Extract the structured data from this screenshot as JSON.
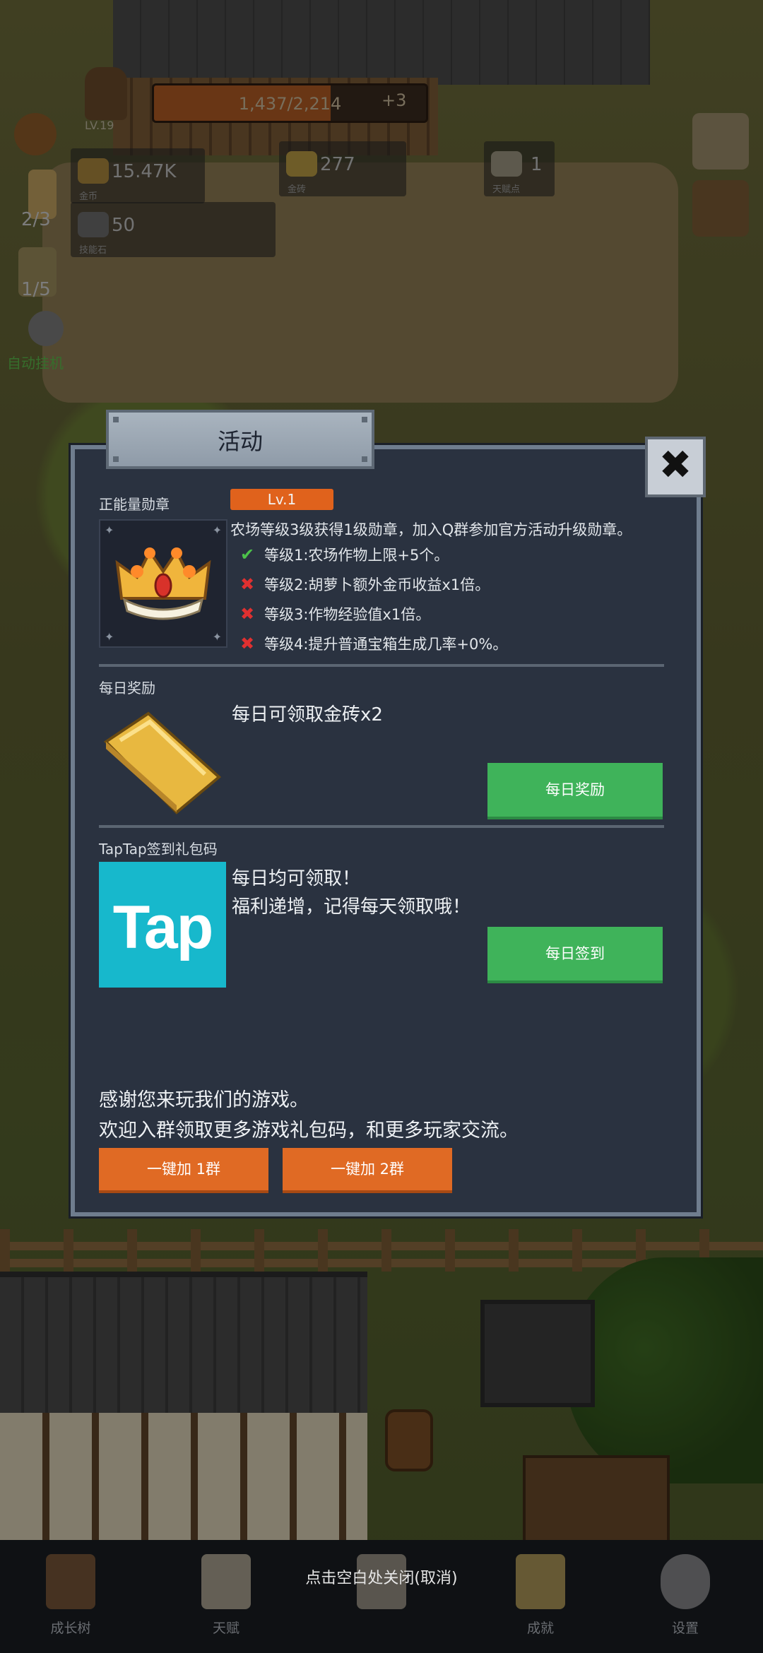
{
  "hud": {
    "level": "LV.19",
    "xp_text": "1,437/2,214",
    "xp_fraction": 0.649,
    "xp_bonus": "+3",
    "resources": [
      {
        "value": "15.47K",
        "caption": "金币"
      },
      {
        "value": "277",
        "caption": "金砖"
      },
      {
        "value": "1",
        "caption": "天赋点"
      },
      {
        "value": "50",
        "caption": "技能石"
      }
    ],
    "side_counters": [
      "2/3",
      "1/5"
    ],
    "side_label": "自动挂机"
  },
  "dialog": {
    "title": "活动",
    "close_glyph": "✖",
    "medal": {
      "section_label": "正能量勋章",
      "level_badge": "Lv.1",
      "description": "农场等级3级获得1级勋章，加入Q群参加官方活动升级勋章。",
      "levels": [
        {
          "status": "done",
          "mark": "✔",
          "text": "等级1:农场作物上限+5个。"
        },
        {
          "status": "locked",
          "mark": "✖",
          "text": "等级2:胡萝卜额外金币收益x1倍。"
        },
        {
          "status": "locked",
          "mark": "✖",
          "text": "等级3:作物经验值x1倍。"
        },
        {
          "status": "locked",
          "mark": "✖",
          "text": "等级4:提升普通宝箱生成几率+0%。"
        }
      ]
    },
    "daily": {
      "section_label": "每日奖励",
      "text": "每日可领取金砖x2",
      "button": "每日奖励"
    },
    "taptap": {
      "section_label": "TapTap签到礼包码",
      "logo_text": "Tap",
      "line1": "每日均可领取！",
      "line2": "福利递增，记得每天领取哦！",
      "button": "每日签到"
    },
    "footer": {
      "line1": "感谢您来玩我们的游戏。",
      "line2": "欢迎入群领取更多游戏礼包码，和更多玩家交流。",
      "group1_button": "一键加 1群",
      "group2_button": "一键加 2群"
    }
  },
  "bottom_nav": {
    "items": [
      {
        "label": "成长树",
        "icon": "book-icon"
      },
      {
        "label": "天赋",
        "icon": "scroll-icon"
      },
      {
        "label": "",
        "icon": "map-icon"
      },
      {
        "label": "成就",
        "icon": "key-icon"
      },
      {
        "label": "设置",
        "icon": "gear-icon"
      }
    ],
    "close_hint": "点击空白处关闭(取消)"
  },
  "colors": {
    "panel_bg": "#2a3240",
    "accent_orange": "#e0621c",
    "button_green": "#3fb35a",
    "tap_blue": "#17b8cc"
  }
}
